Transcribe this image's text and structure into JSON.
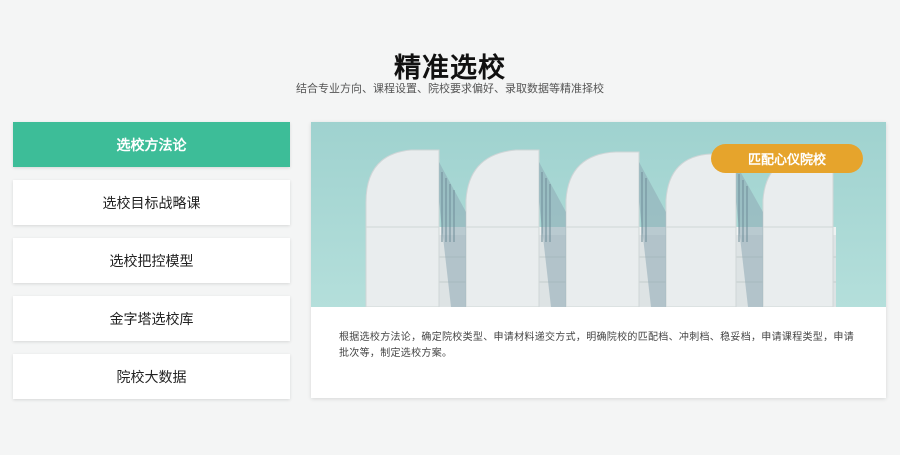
{
  "header": {
    "title": "精准选校",
    "subtitle": "结合专业方向、课程设置、院校要求偏好、录取数据等精准择校"
  },
  "menu": {
    "items": [
      {
        "label": "选校方法论"
      },
      {
        "label": "选校目标战略课"
      },
      {
        "label": "选校把控模型"
      },
      {
        "label": "金字塔选校库"
      },
      {
        "label": "院校大数据"
      }
    ]
  },
  "panel": {
    "button_label": "匹配心仪院校",
    "description": "根据选校方法论，确定院校类型、申请材料递交方式，明确院校的匹配档、冲刺档、稳妥档，申请课程类型，申请批次等，制定选校方案。"
  },
  "colors": {
    "accent": "#3dbd98",
    "button": "#e6a42c",
    "sky": "#a9d8d4"
  }
}
